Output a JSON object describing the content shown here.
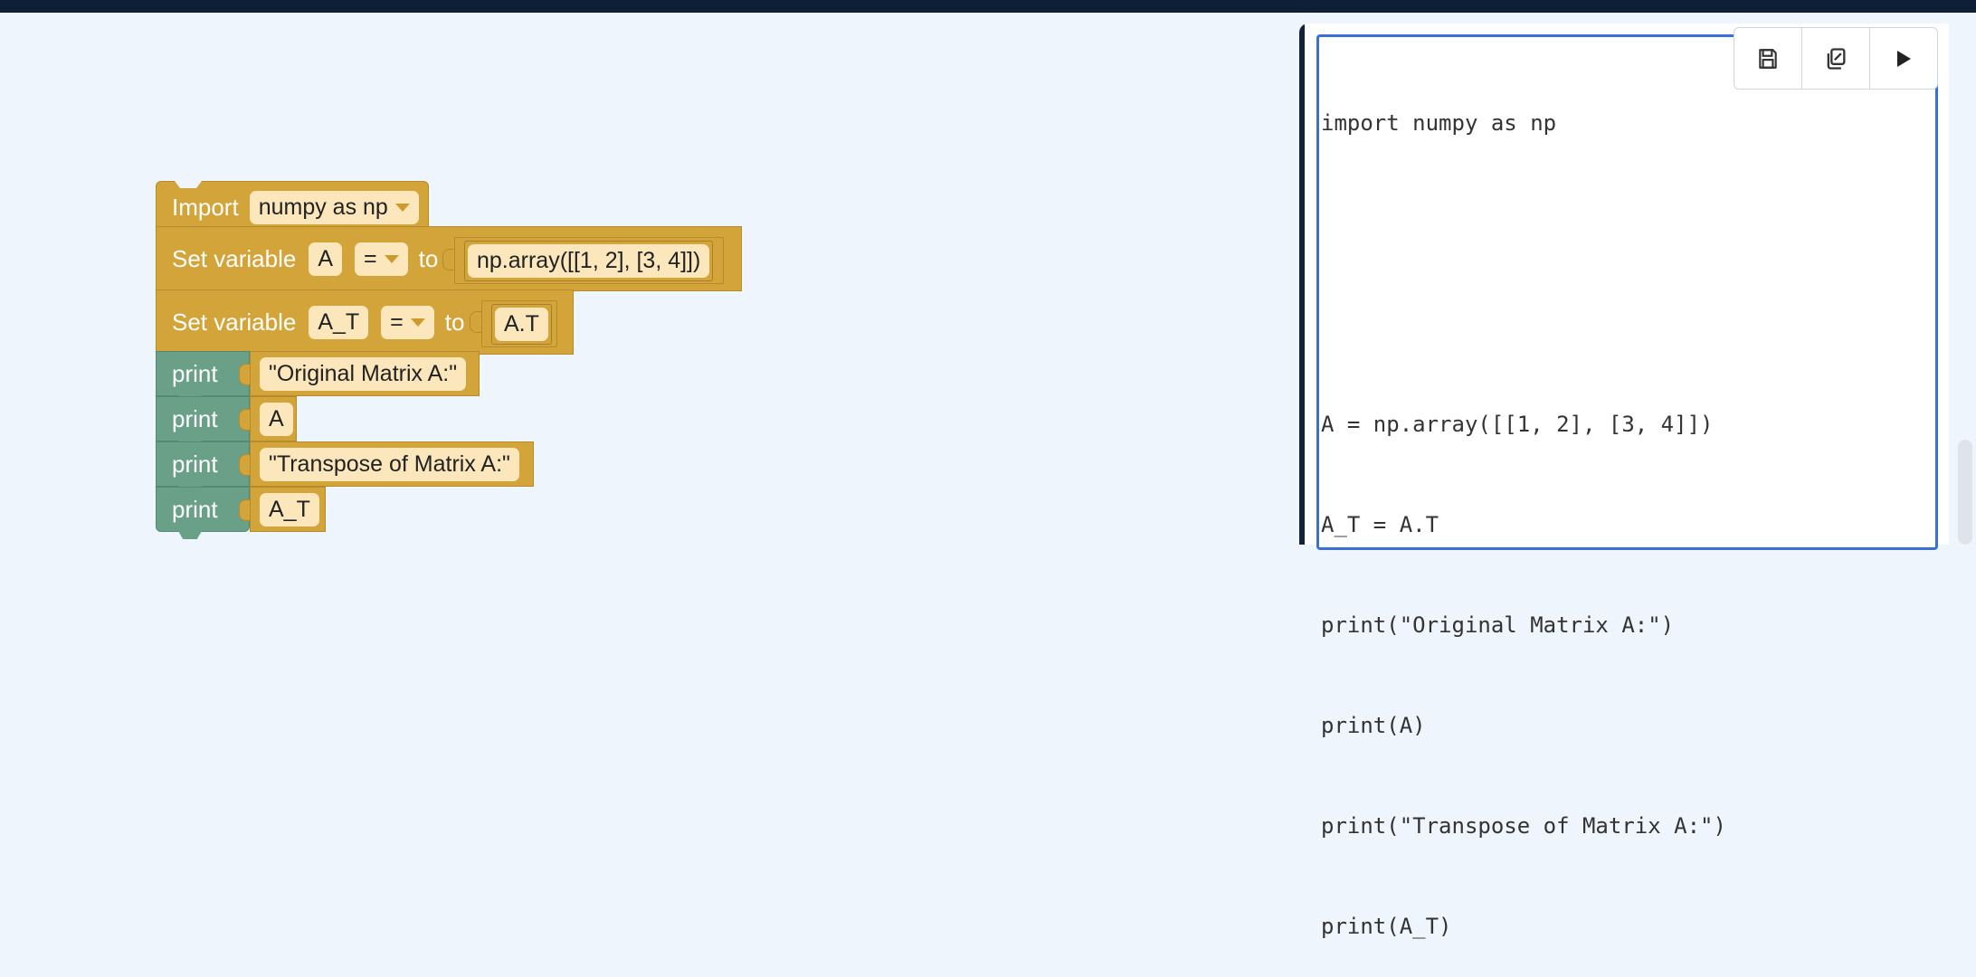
{
  "colors": {
    "top_bar": "#0f1f35",
    "workspace_bg": "#eef5fc",
    "variable_block": "#d3a43a",
    "print_block": "#6aa088",
    "field_bg": "#fbe7bb",
    "editor_border": "#3a6fd4"
  },
  "blocks": {
    "import": {
      "label": "Import",
      "module": "numpy as np"
    },
    "set_a": {
      "label": "Set variable",
      "var": "A",
      "op": "=",
      "to": "to",
      "value": "np.array([[1, 2], [3, 4]])"
    },
    "set_at": {
      "label": "Set variable",
      "var": "A_T",
      "op": "=",
      "to": "to",
      "value": "A.T"
    },
    "prints": [
      {
        "label": "print",
        "value": "\"Original Matrix A:\""
      },
      {
        "label": "print",
        "value": "A"
      },
      {
        "label": "print",
        "value": "\"Transpose of Matrix A:\""
      },
      {
        "label": "print",
        "value": "A_T"
      }
    ]
  },
  "editor": {
    "lines": [
      "import numpy as np",
      "",
      "",
      "A = np.array([[1, 2], [3, 4]])",
      "A_T = A.T",
      "print(\"Original Matrix A:\")",
      "print(A)",
      "print(\"Transpose of Matrix A:\")",
      "print(A_T)"
    ]
  },
  "toolbar": {
    "icons": [
      "save-icon",
      "copy-icon",
      "run-icon"
    ]
  }
}
